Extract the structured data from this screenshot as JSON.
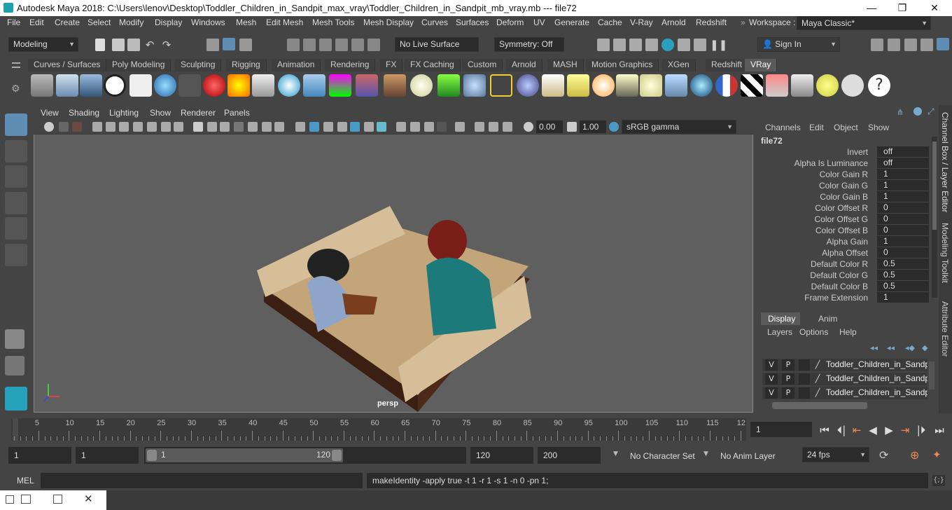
{
  "window": {
    "title": "Autodesk Maya 2018: C:\\Users\\lenov\\Desktop\\Toddler_Children_in_Sandpit_max_vray\\Toddler_Children_in_Sandpit_mb_vray.mb    ---    file72",
    "minimize": "—",
    "maximize": "❐",
    "close": "✕"
  },
  "menu": [
    "File",
    "Edit",
    "Create",
    "Select",
    "Modify",
    "Display",
    "Windows",
    "Mesh",
    "Edit Mesh",
    "Mesh Tools",
    "Mesh Display",
    "Curves",
    "Surfaces",
    "Deform",
    "UV",
    "Generate",
    "Cache",
    "V-Ray",
    "Arnold",
    "Redshift"
  ],
  "workspace": {
    "label": "Workspace :",
    "value": "Maya Classic*"
  },
  "status": {
    "mode": "Modeling",
    "live_surface": "No Live Surface",
    "symmetry": "Symmetry: Off",
    "sign_in": "Sign In"
  },
  "shelf_tabs": [
    "Curves / Surfaces",
    "Poly Modeling",
    "Sculpting",
    "Rigging",
    "Animation",
    "Rendering",
    "FX",
    "FX Caching",
    "Custom",
    "Arnold",
    "MASH",
    "Motion Graphics",
    "XGen",
    "Redshift",
    "VRay"
  ],
  "shelf_active": "VRay",
  "viewport": {
    "menu": [
      "View",
      "Shading",
      "Lighting",
      "Show",
      "Renderer",
      "Panels"
    ],
    "exposure": "0.00",
    "gamma": "1.00",
    "color_space": "sRGB gamma",
    "camera": "persp"
  },
  "channel_box": {
    "menu": [
      "Channels",
      "Edit",
      "Object",
      "Show"
    ],
    "node": "file72",
    "attributes": [
      {
        "label": "Invert",
        "value": "off"
      },
      {
        "label": "Alpha Is Luminance",
        "value": "off"
      },
      {
        "label": "Color Gain R",
        "value": "1"
      },
      {
        "label": "Color Gain G",
        "value": "1"
      },
      {
        "label": "Color Gain B",
        "value": "1"
      },
      {
        "label": "Color Offset R",
        "value": "0"
      },
      {
        "label": "Color Offset G",
        "value": "0"
      },
      {
        "label": "Color Offset B",
        "value": "0"
      },
      {
        "label": "Alpha Gain",
        "value": "1"
      },
      {
        "label": "Alpha Offset",
        "value": "0"
      },
      {
        "label": "Default Color R",
        "value": "0.5"
      },
      {
        "label": "Default Color G",
        "value": "0.5"
      },
      {
        "label": "Default Color B",
        "value": "0.5"
      },
      {
        "label": "Frame Extension",
        "value": "1"
      }
    ]
  },
  "side_tabs": [
    "Channel Box / Layer Editor",
    "Modeling Toolkit",
    "Attribute Editor"
  ],
  "layer_editor": {
    "tabs": [
      "Display",
      "Anim"
    ],
    "menu": [
      "Layers",
      "Options",
      "Help"
    ],
    "layers": [
      {
        "v": "V",
        "p": "P",
        "name": "Toddler_Children_in_Sandpit"
      },
      {
        "v": "V",
        "p": "P",
        "name": "Toddler_Children_in_Sandpit"
      },
      {
        "v": "V",
        "p": "P",
        "name": "Toddler_Children_in_Sandpit"
      }
    ]
  },
  "timeline": {
    "ticks": [
      "5",
      "10",
      "15",
      "20",
      "25",
      "30",
      "35",
      "40",
      "45",
      "50",
      "55",
      "60",
      "65",
      "70",
      "75",
      "80",
      "85",
      "90",
      "95",
      "100",
      "105",
      "110",
      "115",
      "12"
    ],
    "first": "1",
    "current_frame": "1"
  },
  "range": {
    "start": "1",
    "anim_start": "1",
    "slider_start": "1",
    "slider_end": "120",
    "anim_end": "120",
    "end": "200",
    "character_set": "No Character Set",
    "anim_layer": "No Anim Layer",
    "fps": "24 fps"
  },
  "command": {
    "lang": "MEL",
    "result": "makeIdentity -apply true -t 1 -r 1 -s 1 -n 0 -pn 1;"
  }
}
